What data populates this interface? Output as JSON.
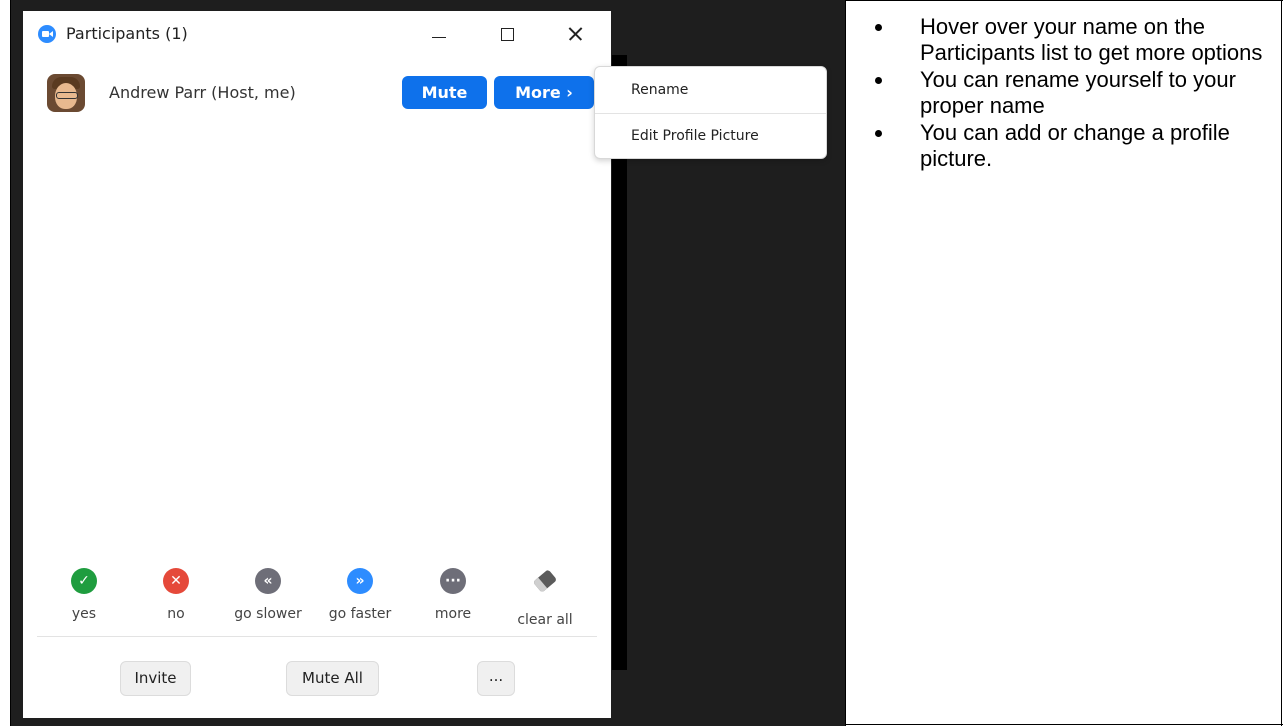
{
  "window": {
    "title": "Participants (1)",
    "controls": [
      "minimize",
      "maximize",
      "close"
    ]
  },
  "participant": {
    "name": "Andrew Parr (Host, me)",
    "mute_label": "Mute",
    "more_label": "More ›"
  },
  "menu": {
    "items": [
      "Rename",
      "Edit Profile Picture"
    ]
  },
  "reactions": [
    {
      "label": "yes",
      "glyph": "✓",
      "color": "#1f9d3f",
      "icon": "check-icon"
    },
    {
      "label": "no",
      "glyph": "✕",
      "color": "#e5493a",
      "icon": "x-icon"
    },
    {
      "label": "go slower",
      "glyph": "«",
      "color": "#6e6e78",
      "icon": "rewind-icon"
    },
    {
      "label": "go faster",
      "glyph": "»",
      "color": "#2d8cff",
      "icon": "fast-forward-icon"
    },
    {
      "label": "more",
      "glyph": "···",
      "color": "#6e6e78",
      "icon": "more-icon"
    },
    {
      "label": "clear all",
      "glyph": "",
      "color": "#5b5b5b",
      "icon": "eraser-icon"
    }
  ],
  "footer": {
    "invite_label": "Invite",
    "mute_all_label": "Mute All",
    "more_label": "..."
  },
  "notes": [
    "Hover over your name on the Participants list to get more options",
    "You can rename yourself to your proper name",
    "You can add or change a profile picture."
  ],
  "colors": {
    "zoom_blue": "#0e71eb",
    "dark_background": "#1e1e1e"
  }
}
